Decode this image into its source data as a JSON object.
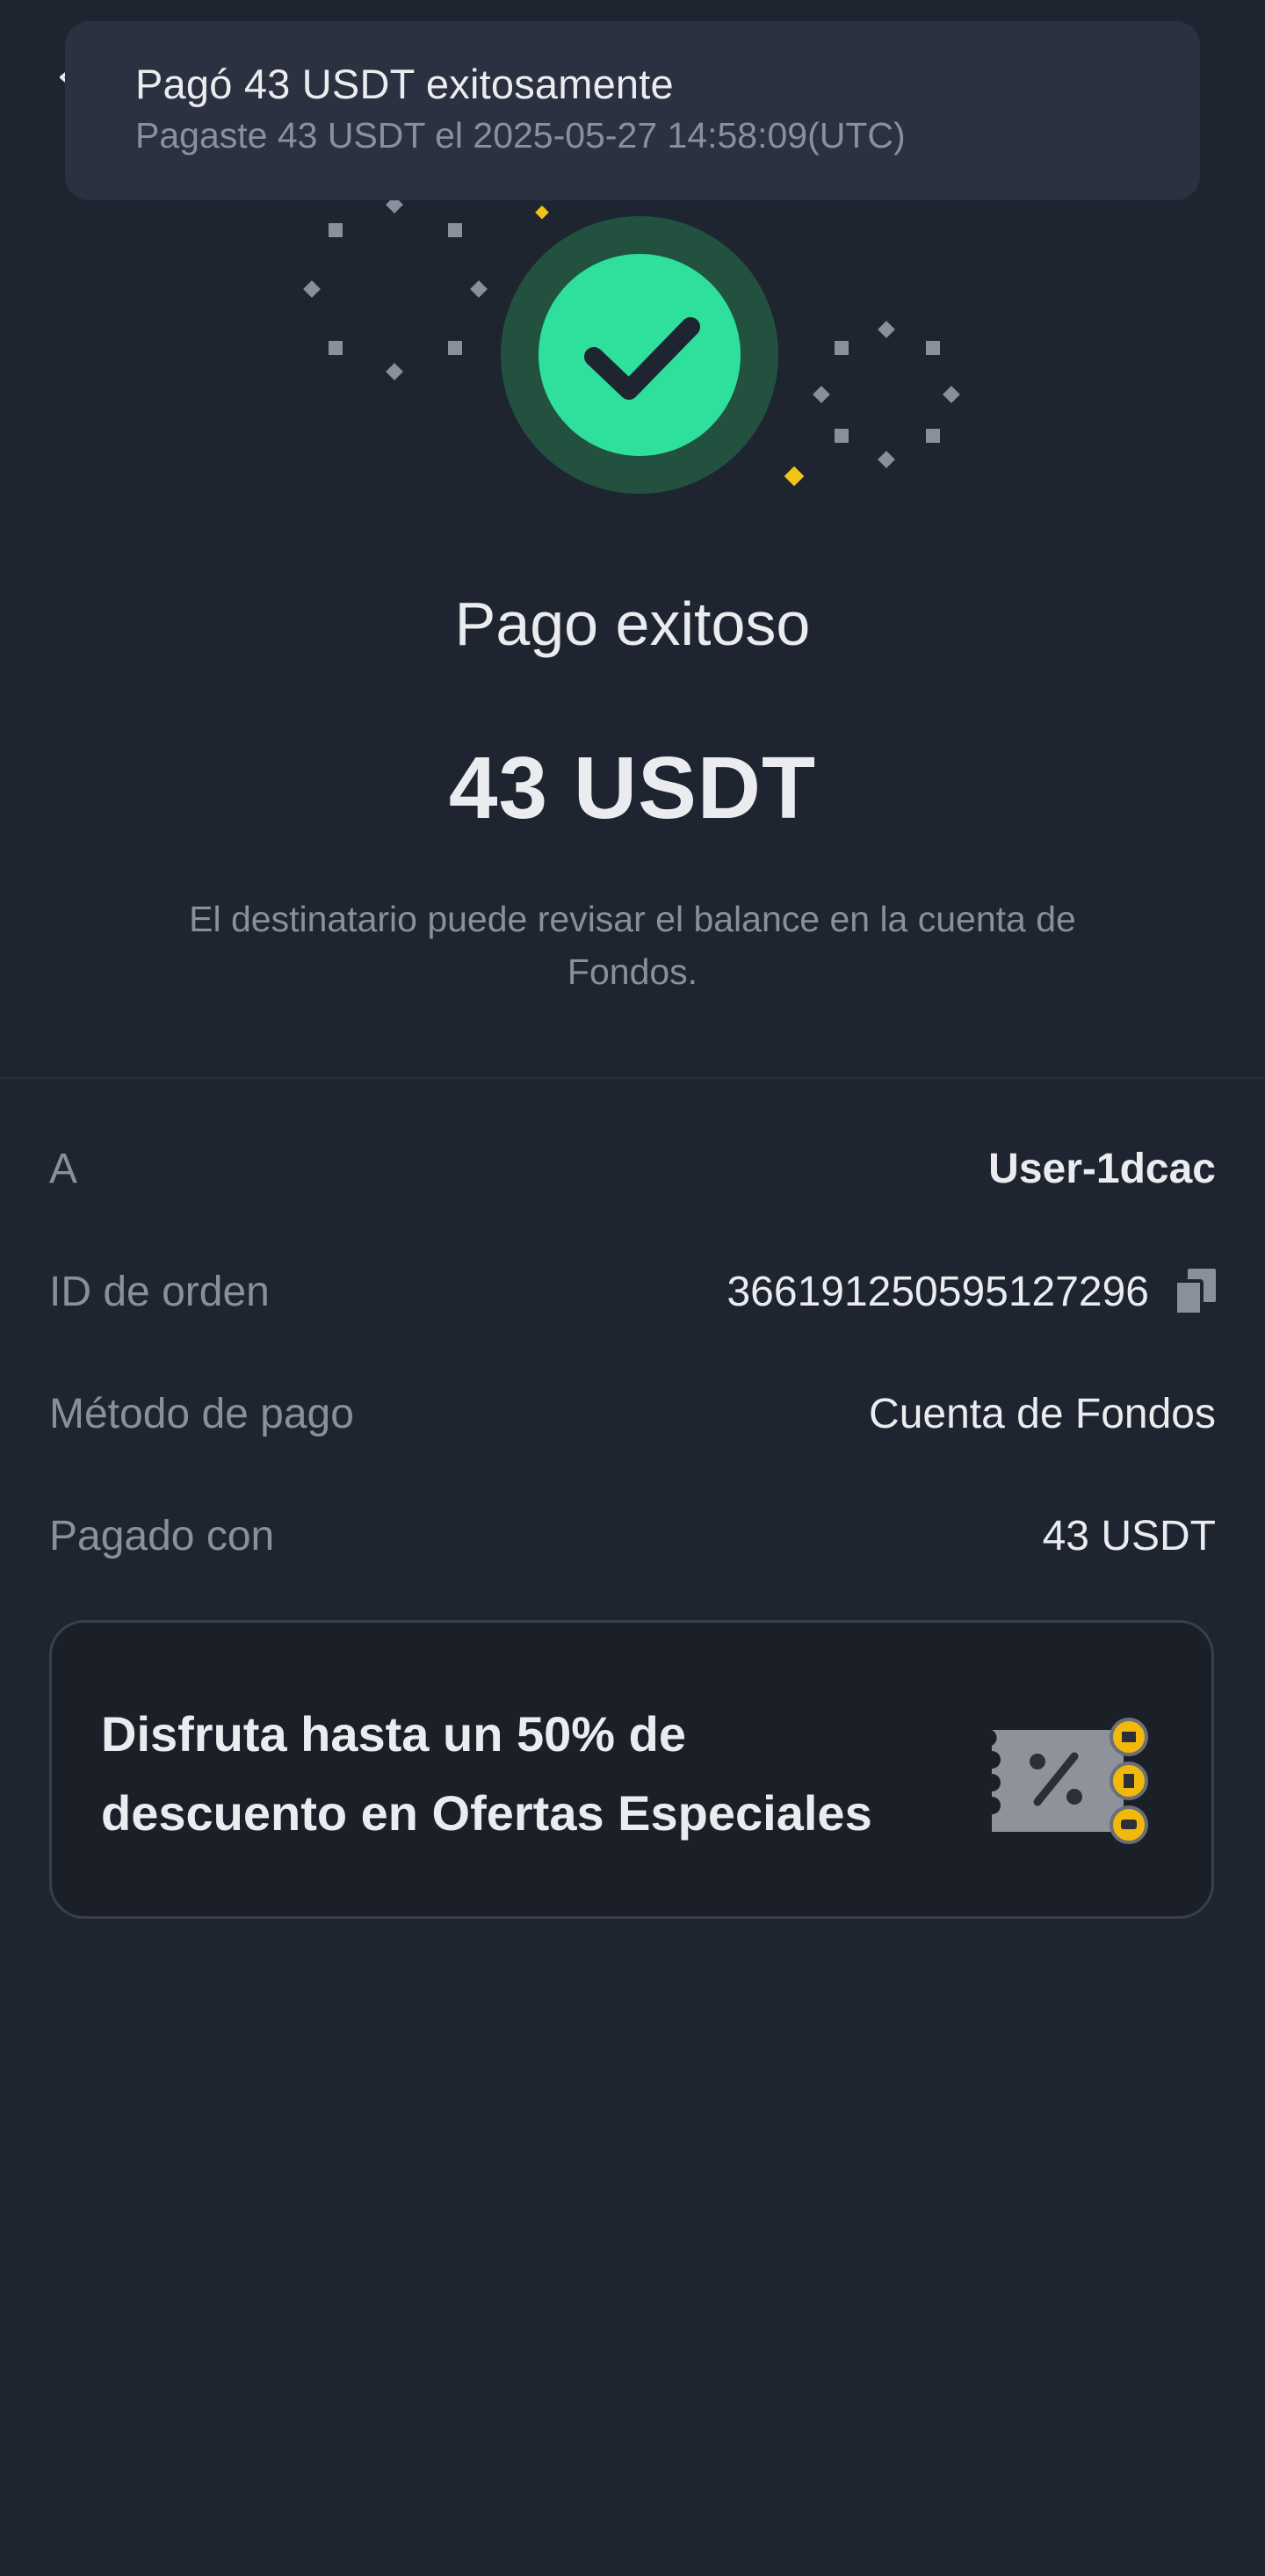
{
  "toast": {
    "title": "Pagó 43 USDT exitosamente",
    "subtitle": "Pagaste 43 USDT el 2025-05-27 14:58:09(UTC)"
  },
  "result": {
    "title": "Pago exitoso",
    "amount": "43 USDT",
    "note": "El destinatario puede revisar el balance en la cuenta de Fondos."
  },
  "details": [
    {
      "label": "A",
      "value": "User-1dcac"
    },
    {
      "label": "ID de orden",
      "value": "366191250595127296"
    },
    {
      "label": "Método de pago",
      "value": "Cuenta de Fondos"
    },
    {
      "label": "Pagado con",
      "value": "43 USDT"
    }
  ],
  "promo": {
    "text": "Disfruta hasta un 50% de descuento en Ofertas Especiales"
  },
  "colors": {
    "background": "#1f2530",
    "success_green": "#2ee09c",
    "accent_yellow": "#f0b90b",
    "muted_text": "#8a909b"
  },
  "icons": {
    "back": "back-arrow-icon",
    "success": "checkmark-icon",
    "copy": "copy-icon",
    "promo": "discount-coupon-icon"
  }
}
